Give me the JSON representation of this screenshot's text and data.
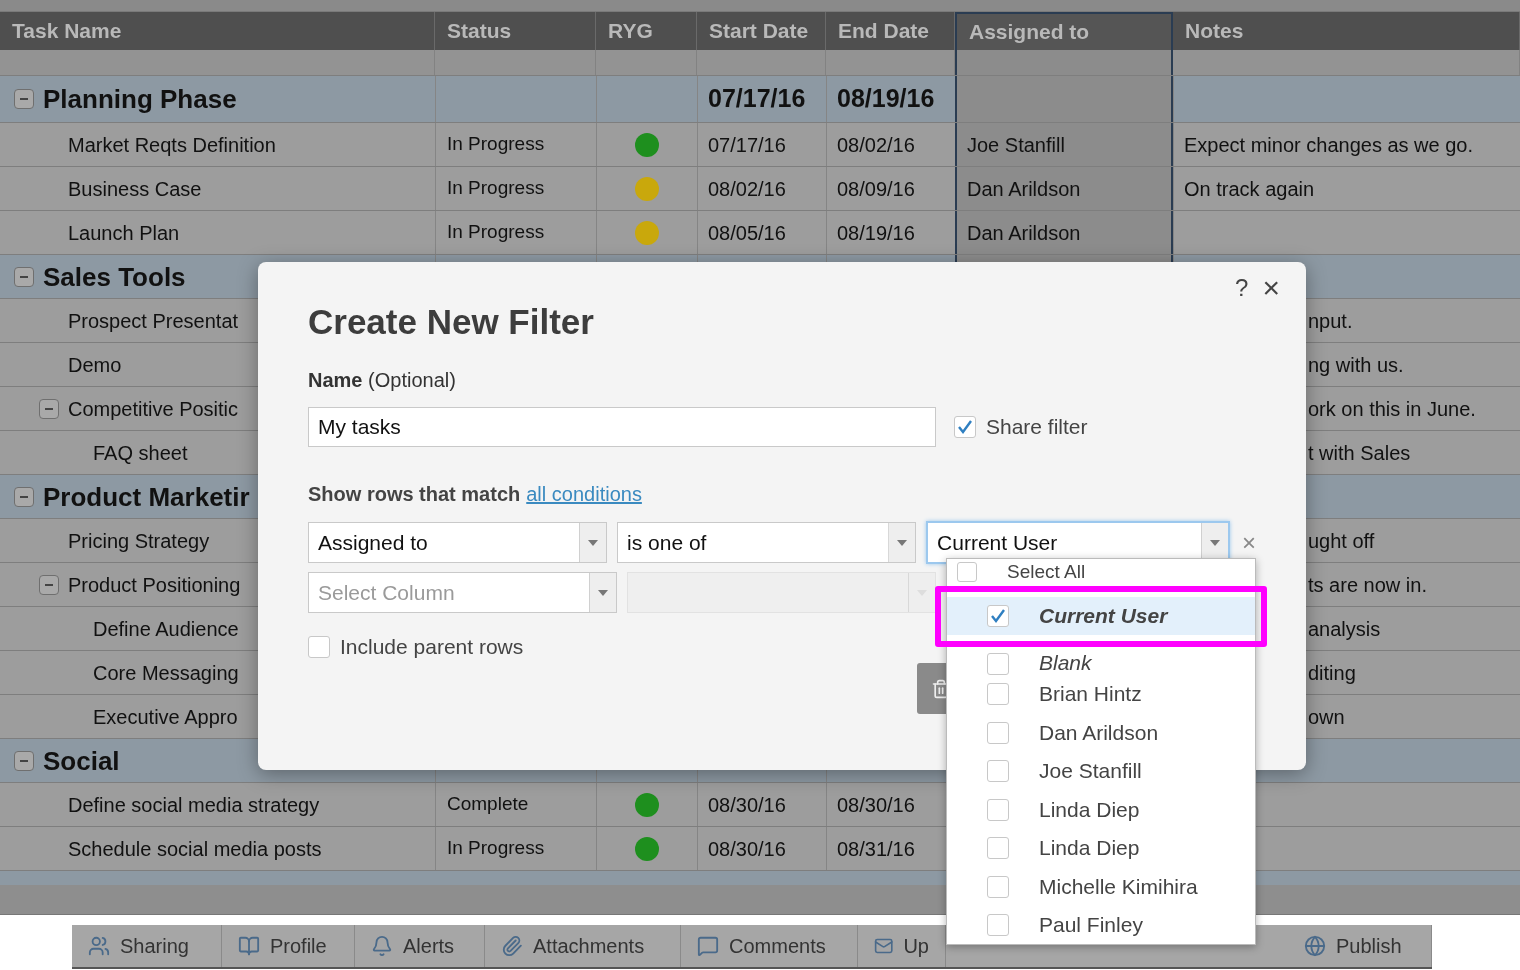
{
  "grid": {
    "columns": [
      {
        "label": "Task Name",
        "selected": false
      },
      {
        "label": "Status",
        "selected": false
      },
      {
        "label": "RYG",
        "selected": false
      },
      {
        "label": "Start Date",
        "selected": false
      },
      {
        "label": "End Date",
        "selected": false
      },
      {
        "label": "Assigned to",
        "selected": true
      },
      {
        "label": "Notes",
        "selected": false
      }
    ],
    "rows": [
      {
        "kind": "group",
        "name": "Planning Phase",
        "expanded": true,
        "start": "07/17/16",
        "end": "08/19/16",
        "children": [
          {
            "kind": "task",
            "name": "Market Reqts Definition",
            "status": "In Progress",
            "color": "#1e8f1e",
            "start": "07/17/16",
            "end": "08/02/16",
            "assigned": "Joe Stanfill",
            "notes": "Expect minor changes as we go."
          },
          {
            "kind": "task",
            "name": "Business Case",
            "status": "In Progress",
            "color": "#c9a80c",
            "start": "08/02/16",
            "end": "08/09/16",
            "assigned": "Dan Arildson",
            "notes": "On track again"
          },
          {
            "kind": "task",
            "name": "Launch Plan",
            "status": "In Progress",
            "color": "#c9a80c",
            "start": "08/05/16",
            "end": "08/19/16",
            "assigned": "Dan Arildson"
          }
        ]
      },
      {
        "kind": "group",
        "name": "Sales Tools",
        "expanded": true,
        "children": [
          {
            "kind": "task",
            "name": "Prospect Presentat",
            "notes": "nput."
          },
          {
            "kind": "task",
            "name": "Demo",
            "notes": "ng with us."
          },
          {
            "kind": "task",
            "name": "Competitive Positic",
            "expanded": true,
            "notes": "ork on this in June.",
            "children": [
              {
                "kind": "task",
                "name": "FAQ sheet",
                "notes": "t with Sales"
              }
            ]
          }
        ]
      },
      {
        "kind": "group",
        "name": "Product Marketir",
        "expanded": true,
        "children": [
          {
            "kind": "task",
            "name": "Pricing Strategy",
            "notes": "ught off"
          },
          {
            "kind": "task",
            "name": "Product Positioning",
            "expanded": true,
            "notes": "ts are now in.",
            "children": [
              {
                "kind": "task",
                "name": "Define Audience",
                "notes": "analysis"
              },
              {
                "kind": "task",
                "name": "Core Messaging",
                "notes": "diting"
              },
              {
                "kind": "task",
                "name": "Executive Appro",
                "notes": "own"
              }
            ]
          }
        ]
      },
      {
        "kind": "group",
        "name": "Social",
        "expanded": true,
        "children": [
          {
            "kind": "task",
            "name": "Define social media strategy",
            "status": "Complete",
            "color": "#1e8f1e",
            "start": "08/30/16",
            "end": "08/30/16"
          },
          {
            "kind": "task",
            "name": "Schedule social media posts",
            "status": "In Progress",
            "color": "#1e8f1e",
            "start": "08/30/16",
            "end": "08/31/16"
          }
        ]
      }
    ]
  },
  "dialog": {
    "title": "Create New Filter",
    "help": "?",
    "close": "×",
    "name_label": "**Name** (Optional)",
    "name_value": "My tasks",
    "share": {
      "label": "Share filter",
      "checked": true
    },
    "match_label": "Show rows that match",
    "match_link": "all conditions",
    "conditions": [
      {
        "column": "Assigned to",
        "operator": "is one of",
        "value": "Current User",
        "focused": true,
        "disabled": false,
        "remove": "×"
      },
      {
        "column_placeholder": "Select Column",
        "disabled": true
      }
    ],
    "include_parent": {
      "label": "Include parent rows",
      "checked": false
    },
    "options": [
      {
        "label": "Select All",
        "checked": false,
        "selected": false,
        "kind": "all"
      },
      {
        "label": "Current User",
        "checked": true,
        "selected": true,
        "kind": "special"
      },
      {
        "label": "Blank",
        "checked": false,
        "selected": false,
        "kind": "special"
      },
      {
        "label": "Brian Hintz",
        "checked": false,
        "selected": false,
        "kind": "user"
      },
      {
        "label": "Dan Arildson",
        "checked": false,
        "selected": false,
        "kind": "user"
      },
      {
        "label": "Joe Stanfill",
        "checked": false,
        "selected": false,
        "kind": "user"
      },
      {
        "label": "Linda Diep",
        "checked": false,
        "selected": false,
        "kind": "user"
      },
      {
        "label": "Linda Diep",
        "checked": false,
        "selected": false,
        "kind": "user"
      },
      {
        "label": "Michelle Kimihira",
        "checked": false,
        "selected": false,
        "kind": "user"
      },
      {
        "label": "Paul Finley",
        "checked": false,
        "selected": false,
        "kind": "user"
      }
    ]
  },
  "toolbar": [
    {
      "label": "Sharing"
    },
    {
      "label": "Profile"
    },
    {
      "label": "Alerts"
    },
    {
      "label": "Attachments"
    },
    {
      "label": "Comments"
    },
    {
      "label": "Up"
    },
    {
      "label": "Publish"
    }
  ]
}
